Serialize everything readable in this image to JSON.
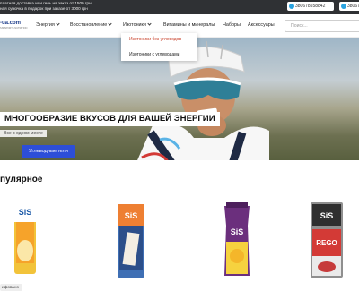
{
  "topbar": {
    "promo_line1": "платная доставка или гель на заказ от 1500 грн",
    "promo_line2": "ная сумочка в подарок при заказе от 3000 грн",
    "phone1": "380678558842",
    "phone2": "38067"
  },
  "header": {
    "logo_text": "-ua.com",
    "logo_sub": "SIS SPORTS NUTRITION"
  },
  "nav": {
    "items": [
      {
        "label": "Энергия"
      },
      {
        "label": "Восстановление"
      },
      {
        "label": "Изотоники"
      },
      {
        "label": "Витамины и минералы"
      },
      {
        "label": "Наборы"
      },
      {
        "label": "Аксессуары"
      }
    ]
  },
  "search": {
    "placeholder": "Поиск..."
  },
  "dropdown": {
    "items": [
      {
        "label": "Изотоники без углеводов"
      },
      {
        "label": "Изотоники с углеводами"
      }
    ]
  },
  "hero": {
    "title": "МНОГООБРАЗИЕ ВКУСОВ ДЛЯ ВАШЕЙ ЭНЕРГИИ",
    "subtitle": "Все в одном месте",
    "button_label": "Углеводные гели"
  },
  "popular": {
    "title": "пулярное",
    "badge": "ифовано"
  },
  "products": [
    {
      "brand": "SiS",
      "name": "GO ENERGY BAKE",
      "color": "#f2c33a"
    },
    {
      "brand": "SiS",
      "name": "PROTEIN20",
      "color": "#3f6fb4"
    },
    {
      "brand": "SiS",
      "name": "GO",
      "color": "#6b2f7d"
    },
    {
      "brand": "SiS",
      "name": "REGO",
      "color": "#d33a36"
    }
  ],
  "colors": {
    "accent_blue": "#2d4ed8",
    "active_red": "#c8402a",
    "topbar_bg": "#2f3134"
  }
}
